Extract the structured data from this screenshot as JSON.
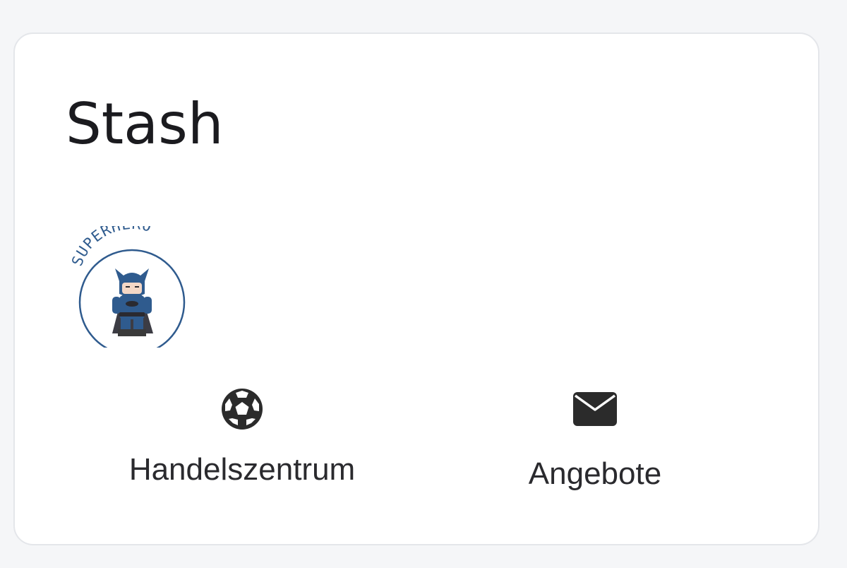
{
  "stash": {
    "title": "Stash",
    "badge": {
      "text": "SUPERHERO",
      "icon": "superhero-badge-icon"
    },
    "actions": [
      {
        "label": "Handelszentrum",
        "icon": "soccer-ball-icon"
      },
      {
        "label": "Angebote",
        "icon": "envelope-icon"
      }
    ]
  },
  "colors": {
    "page_bg": "#f5f6f8",
    "card_bg": "#ffffff",
    "card_border": "#e4e6ea",
    "text": "#1b1b1f",
    "icon": "#2b2b2b",
    "badge_blue": "#2f5b8e"
  }
}
